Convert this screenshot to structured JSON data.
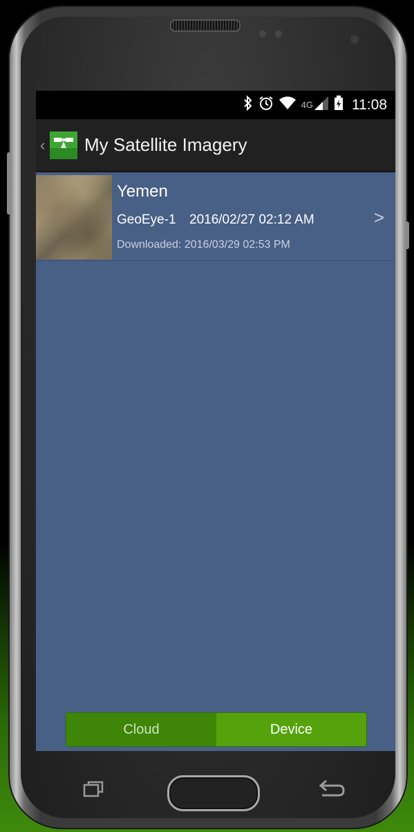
{
  "status_bar": {
    "icons": [
      "bluetooth-icon",
      "alarm-icon",
      "wifi-icon",
      "4g-lte-icon",
      "signal-icon",
      "battery-charging-icon"
    ],
    "network_label": "4G",
    "time": "11:08"
  },
  "action_bar": {
    "title": "My Satellite Imagery",
    "back_glyph": "‹"
  },
  "imagery_list": [
    {
      "name": "Yemen",
      "satellite": "GeoEye-1",
      "captured": "2016/02/27 02:12 AM",
      "downloaded": "Downloaded: 2016/03/29 02:53 PM",
      "chevron": ">"
    }
  ],
  "segment": {
    "cloud_label": "Cloud",
    "device_label": "Device",
    "selected": "Device"
  },
  "colors": {
    "list_background": "#485f86",
    "action_bar": "#212121",
    "segment_cloud": "#3e8508",
    "segment_device": "#55a20c"
  }
}
